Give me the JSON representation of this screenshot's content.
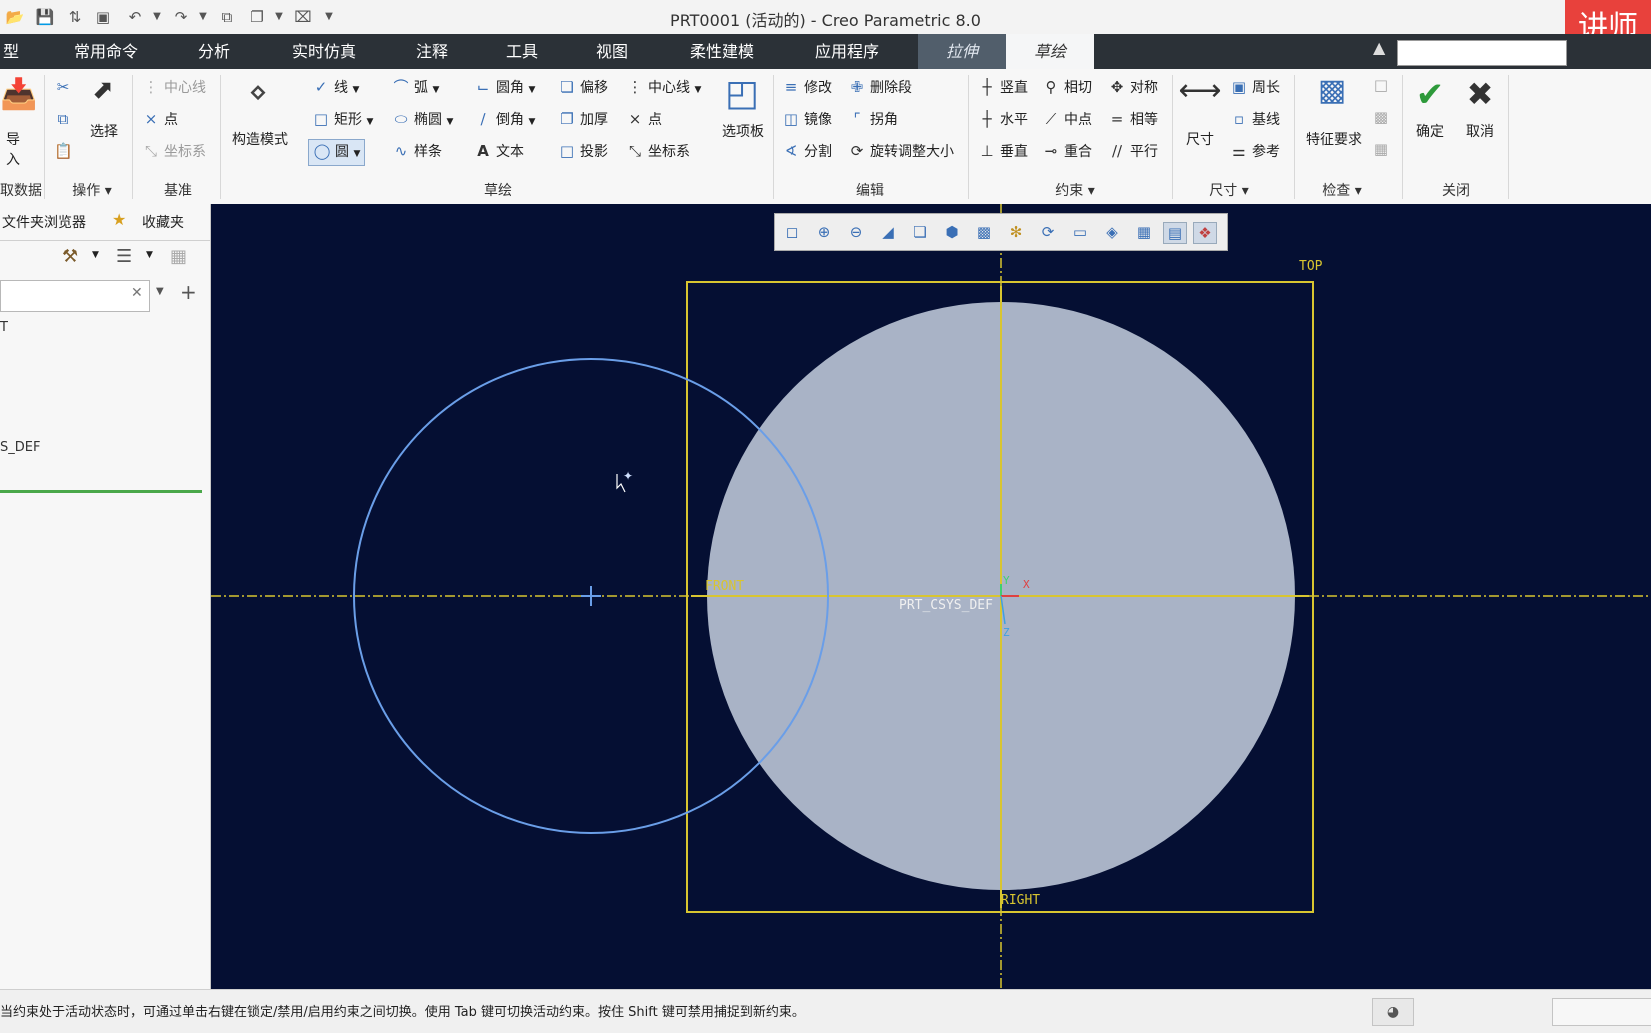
{
  "window": {
    "title": "PRT0001 (活动的) - Creo Parametric 8.0"
  },
  "watermark": "讲师",
  "quick_access": [
    "open-icon",
    "save-icon",
    "regenerate-icon",
    "window-icon",
    "undo-icon",
    "redo-icon",
    "copy-icon",
    "switch-window-icon",
    "close-icon",
    "customize-icon"
  ],
  "menu_tabs": [
    {
      "label": "型"
    },
    {
      "label": "常用命令"
    },
    {
      "label": "分析"
    },
    {
      "label": "实时仿真"
    },
    {
      "label": "注释"
    },
    {
      "label": "工具"
    },
    {
      "label": "视图"
    },
    {
      "label": "柔性建模"
    },
    {
      "label": "应用程序"
    },
    {
      "label": "拉伸"
    },
    {
      "label": "草绘"
    }
  ],
  "ribbon": {
    "groups": {
      "get_data": "取数据",
      "operations": "操作",
      "datum": "基准",
      "sketch": "草绘",
      "edit": "编辑",
      "constrain": "约束",
      "dimension": "尺寸",
      "inspect": "检查",
      "close": "关闭"
    },
    "import_label": "导入",
    "select_label": "选择",
    "datum_items": [
      "中心线",
      "点",
      "坐标系"
    ],
    "construction_mode": "构造模式",
    "sketch_col1": [
      "线",
      "矩形",
      "圆"
    ],
    "sketch_col2": [
      "弧",
      "椭圆",
      "样条"
    ],
    "sketch_col3": [
      "圆角",
      "倒角",
      "文本"
    ],
    "sketch_col4": [
      "偏移",
      "加厚",
      "投影"
    ],
    "sketch_col5": [
      "中心线",
      "点",
      "坐标系"
    ],
    "palette": "选项板",
    "edit_col1": [
      "修改",
      "镜像",
      "分割"
    ],
    "edit_col2": [
      "删除段",
      "拐角",
      "旋转调整大小"
    ],
    "constrain_col1": [
      "竖直",
      "水平",
      "垂直"
    ],
    "constrain_col2": [
      "相切",
      "中点",
      "重合"
    ],
    "constrain_col3": [
      "对称",
      "相等",
      "平行"
    ],
    "dimension_big": "尺寸",
    "dimension_col": [
      "周长",
      "基线",
      "参考"
    ],
    "feature_req": "特征要求",
    "ok": "确定",
    "cancel": "取消"
  },
  "left_panel": {
    "tabs": [
      "文件夹浏览器",
      "收藏夹"
    ],
    "tree_items": [
      "T",
      "S_DEF"
    ]
  },
  "canvas": {
    "labels": {
      "top": "TOP",
      "front": "FRONT",
      "right": "RIGHT",
      "csys": "PRT_CSYS_DEF",
      "x": "X",
      "y": "Y",
      "z": "Z"
    },
    "colors": {
      "background": "#050f33",
      "datum": "#d8c530",
      "circle": "#6a9ee8",
      "fill": "#a9b3c6"
    }
  },
  "view_toolbar": [
    "refit-icon",
    "zoom-in-icon",
    "zoom-out-icon",
    "repaint-icon",
    "orientation-icon",
    "saved-views-icon",
    "display-style-icon",
    "datum-display-icon",
    "spin-center-icon",
    "view-normal-icon",
    "perspective-icon",
    "annotation-display-icon",
    "sketch-display-icon",
    "sketcher-settings-icon"
  ],
  "status": {
    "message": "当约束处于活动状态时，可通过单击右键在锁定/禁用/启用约束之间切换。使用 Tab 键可切换活动约束。按住 Shift 键可禁用捕捉到新约束。"
  }
}
